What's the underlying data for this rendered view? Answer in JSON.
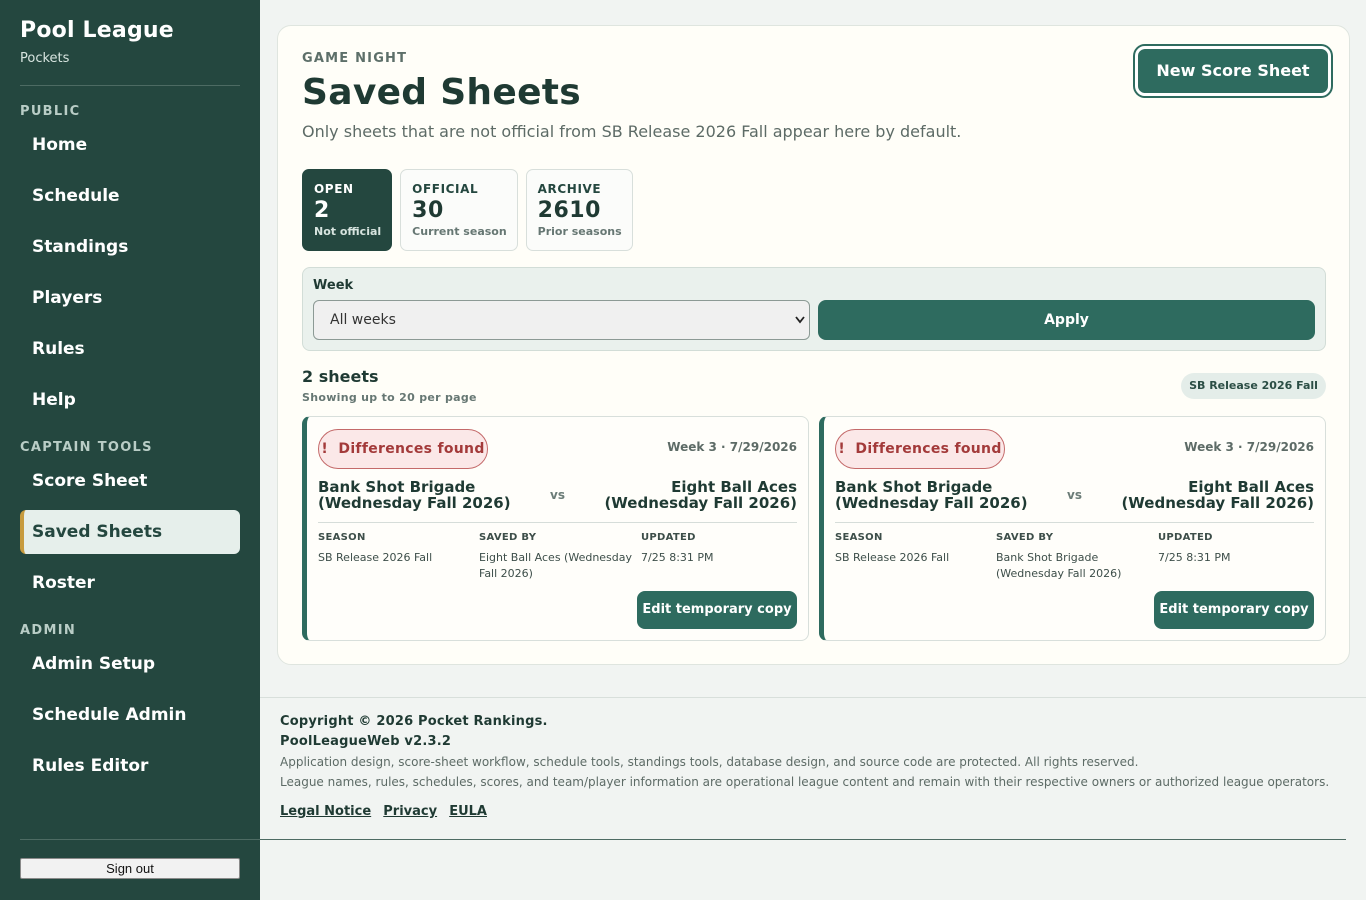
{
  "sidebar": {
    "title": "Pool League",
    "subtitle": "Pockets",
    "sections": {
      "public": "PUBLIC",
      "captain": "CAPTAIN TOOLS",
      "admin": "ADMIN"
    },
    "public_items": [
      "Home",
      "Schedule",
      "Standings",
      "Players",
      "Rules",
      "Help"
    ],
    "captain_items": [
      "Score Sheet",
      "Saved Sheets",
      "Roster"
    ],
    "admin_items": [
      "Admin Setup",
      "Schedule Admin",
      "Rules Editor"
    ],
    "active_item": "Saved Sheets",
    "signout": "Sign out"
  },
  "header": {
    "eyebrow": "GAME NIGHT",
    "title": "Saved Sheets",
    "description": "Only sheets that are not official from SB Release 2026 Fall appear here by default.",
    "new_button": "New Score Sheet"
  },
  "stats": [
    {
      "label": "OPEN",
      "value": "2",
      "sub": "Not official",
      "active": true
    },
    {
      "label": "OFFICIAL",
      "value": "30",
      "sub": "Current season",
      "active": false
    },
    {
      "label": "ARCHIVE",
      "value": "2610",
      "sub": "Prior seasons",
      "active": false
    }
  ],
  "filter": {
    "week_label": "Week",
    "week_value": "All weeks",
    "apply": "Apply"
  },
  "list": {
    "count": "2 sheets",
    "per_page": "Showing up to 20 per page",
    "season_badge": "SB Release 2026 Fall"
  },
  "sheets": [
    {
      "badge": "Differences found",
      "week_date": "Week 3 · 7/29/2026",
      "home": "Bank Shot Brigade (Wednesday Fall 2026)",
      "vs": "vs",
      "away": "Eight Ball Aces (Wednesday Fall 2026)",
      "season_label": "SEASON",
      "season": "SB Release 2026 Fall",
      "saved_by_label": "SAVED BY",
      "saved_by": "Eight Ball Aces (Wednesday Fall 2026)",
      "updated_label": "UPDATED",
      "updated": "7/25 8:31 PM",
      "edit": "Edit temporary copy"
    },
    {
      "badge": "Differences found",
      "week_date": "Week 3 · 7/29/2026",
      "home": "Bank Shot Brigade (Wednesday Fall 2026)",
      "vs": "vs",
      "away": "Eight Ball Aces (Wednesday Fall 2026)",
      "season_label": "SEASON",
      "season": "SB Release 2026 Fall",
      "saved_by_label": "SAVED BY",
      "saved_by": "Bank Shot Brigade (Wednesday Fall 2026)",
      "updated_label": "UPDATED",
      "updated": "7/25 8:31 PM",
      "edit": "Edit temporary copy"
    }
  ],
  "footer": {
    "copyright": "Copyright © 2026 Pocket Rankings.",
    "version": "PoolLeagueWeb v2.3.2",
    "line1": "Application design, score-sheet workflow, schedule tools, standings tools, database design, and source code are protected. All rights reserved.",
    "line2": "League names, rules, schedules, scores, and team/player information are operational league content and remain with their respective owners or authorized league operators.",
    "links": [
      "Legal Notice",
      "Privacy",
      "EULA"
    ]
  }
}
